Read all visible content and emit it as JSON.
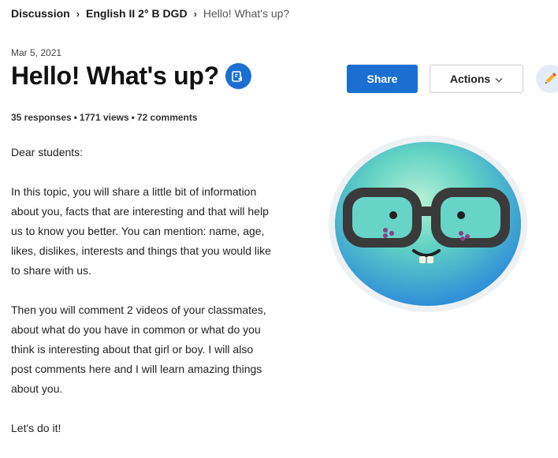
{
  "breadcrumb": {
    "items": [
      "Discussion",
      "English II 2° B DGD"
    ],
    "current": "Hello! What's up?"
  },
  "post": {
    "date": "Mar 5, 2021",
    "title": "Hello! What's up?",
    "stats": {
      "responses": "35 responses",
      "views": "1771 views",
      "comments": "72 comments"
    },
    "paragraphs": [
      "Dear students:",
      "In this topic, you will share a little bit of information about you, facts that are interesting and that will help us to know you better. You can mention: name, age, likes, dislikes, interests and things that you would like to share with us.",
      "Then you will comment 2 videos of your classmates, about what do you have in common or what do you think is interesting about that girl or boy. I will also post comments here and I will learn amazing things about you.",
      "Let's do it!"
    ]
  },
  "toolbar": {
    "share_label": "Share",
    "actions_label": "Actions"
  },
  "icons": {
    "tts": "immersive-reader-icon",
    "chevron": "chevron-down-icon",
    "edit": "pencil-icon",
    "avatar": "glasses-character-avatar"
  },
  "colors": {
    "primary": "#1b6fd1",
    "avatar_teal": "#5fd0c4",
    "avatar_blue": "#3a9ee0"
  }
}
